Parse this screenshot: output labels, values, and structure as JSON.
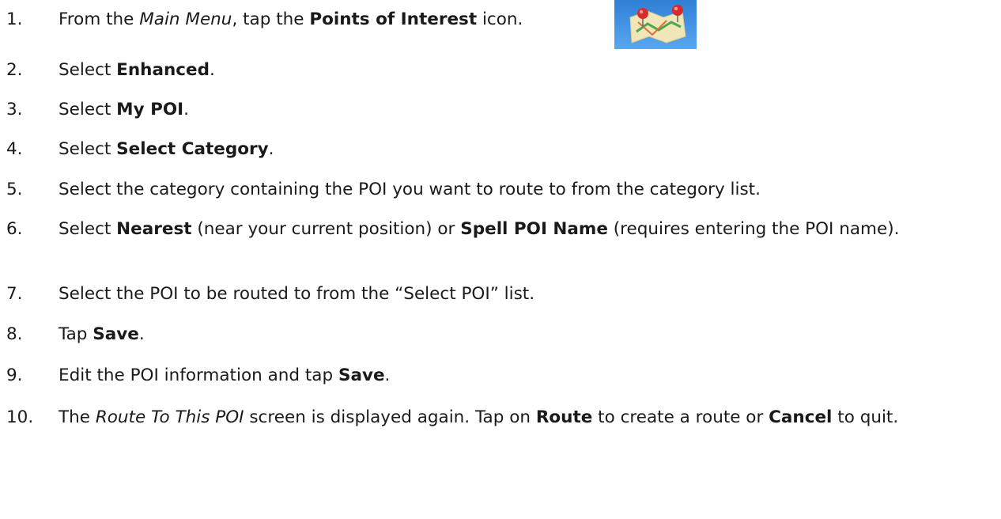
{
  "steps": [
    {
      "num": "1.",
      "parts": [
        {
          "t": "From the "
        },
        {
          "t": "Main Menu",
          "s": "i"
        },
        {
          "t": ", tap the "
        },
        {
          "t": "Points of Interest",
          "s": "b"
        },
        {
          "t": " icon."
        }
      ]
    },
    {
      "num": "2.",
      "parts": [
        {
          "t": "Select "
        },
        {
          "t": "Enhanced",
          "s": "b"
        },
        {
          "t": "."
        }
      ]
    },
    {
      "num": "3.",
      "parts": [
        {
          "t": "Select "
        },
        {
          "t": "My POI",
          "s": "b"
        },
        {
          "t": "."
        }
      ]
    },
    {
      "num": "4.",
      "parts": [
        {
          "t": "Select "
        },
        {
          "t": "Select Category",
          "s": "b"
        },
        {
          "t": "."
        }
      ]
    },
    {
      "num": "5.",
      "parts": [
        {
          "t": "Select the category containing the POI you want to route to from the category list."
        }
      ]
    },
    {
      "num": "6.",
      "parts": [
        {
          "t": "Select "
        },
        {
          "t": "Nearest",
          "s": "b"
        },
        {
          "t": " (near your current position) or "
        },
        {
          "t": "Spell POI Name",
          "s": "b"
        },
        {
          "t": " (requires entering the POI name)."
        }
      ]
    },
    {
      "num": "7.",
      "parts": [
        {
          "t": "Select the POI to be routed to from the “Select POI” list."
        }
      ]
    },
    {
      "num": "8.",
      "parts": [
        {
          "t": "Tap "
        },
        {
          "t": "Save",
          "s": "b"
        },
        {
          "t": "."
        }
      ]
    },
    {
      "num": "9.",
      "parts": [
        {
          "t": "Edit the POI information and tap "
        },
        {
          "t": "Save",
          "s": "b"
        },
        {
          "t": "."
        }
      ]
    },
    {
      "num": "10.",
      "parts": [
        {
          "t": "The "
        },
        {
          "t": "Route To This POI",
          "s": "i"
        },
        {
          "t": " screen is displayed again.  Tap on "
        },
        {
          "t": "Route",
          "s": "b"
        },
        {
          "t": " to create a route or "
        },
        {
          "t": "Cancel",
          "s": "b"
        },
        {
          "t": " to quit."
        }
      ]
    }
  ],
  "icons": {
    "poi": "points-of-interest-map-icon"
  }
}
